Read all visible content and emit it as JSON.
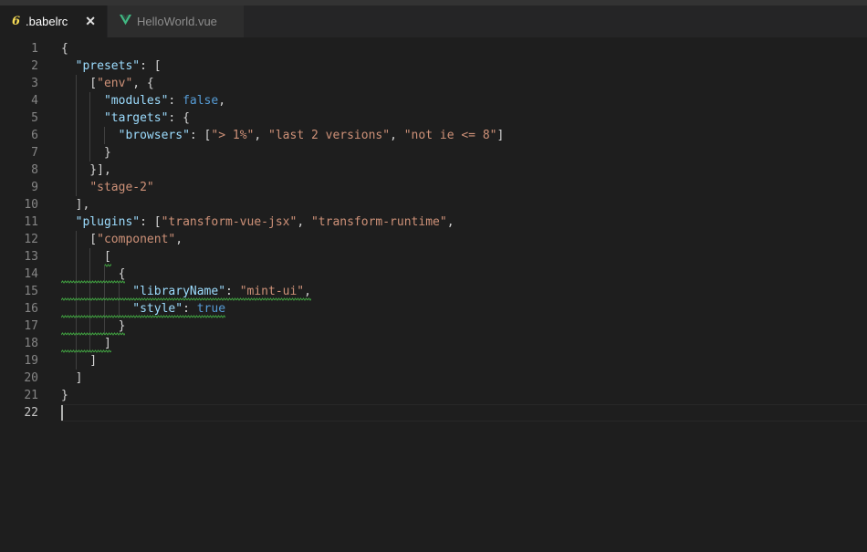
{
  "tabs": [
    {
      "label": ".babelrc",
      "icon": "babel-icon",
      "icon_glyph": "6",
      "active": true,
      "close_glyph": "✕"
    },
    {
      "label": "HelloWorld.vue",
      "icon": "vue-icon",
      "active": false
    }
  ],
  "editor": {
    "current_line": 22,
    "lines": [
      {
        "n": "1",
        "text": "{"
      },
      {
        "n": "2",
        "text": "  \"presets\": ["
      },
      {
        "n": "3",
        "text": "    [\"env\", {"
      },
      {
        "n": "4",
        "text": "      \"modules\": false,"
      },
      {
        "n": "5",
        "text": "      \"targets\": {"
      },
      {
        "n": "6",
        "text": "        \"browsers\": [\"> 1%\", \"last 2 versions\", \"not ie <= 8\"]"
      },
      {
        "n": "7",
        "text": "      }"
      },
      {
        "n": "8",
        "text": "    }],"
      },
      {
        "n": "9",
        "text": "    \"stage-2\""
      },
      {
        "n": "10",
        "text": "  ],"
      },
      {
        "n": "11",
        "text": "  \"plugins\": [\"transform-vue-jsx\", \"transform-runtime\","
      },
      {
        "n": "12",
        "text": "    [\"component\","
      },
      {
        "n": "13",
        "text": "      ["
      },
      {
        "n": "14",
        "text": "        {"
      },
      {
        "n": "15",
        "text": "          \"libraryName\": \"mint-ui\","
      },
      {
        "n": "16",
        "text": "          \"style\": true"
      },
      {
        "n": "17",
        "text": "        }"
      },
      {
        "n": "18",
        "text": "      ]"
      },
      {
        "n": "19",
        "text": "    ]"
      },
      {
        "n": "20",
        "text": "  ]"
      },
      {
        "n": "21",
        "text": "}"
      },
      {
        "n": "22",
        "text": ""
      }
    ]
  }
}
